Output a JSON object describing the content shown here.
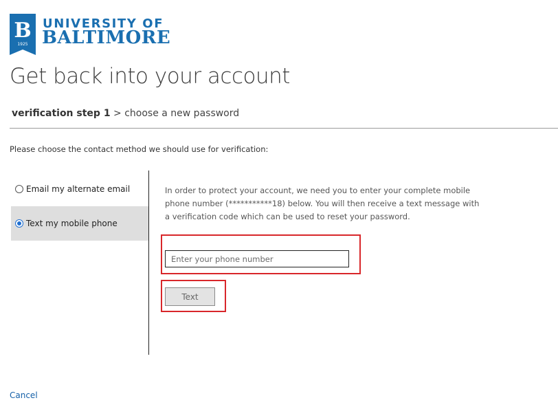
{
  "logo": {
    "line1": "UNIVERSITY OF",
    "line2": "BALTIMORE",
    "shield_letter": "B",
    "shield_year": "1925",
    "brand_color": "#1a6fb0"
  },
  "page": {
    "title": "Get back into your account"
  },
  "steps": {
    "current": "verification step 1",
    "separator": ">",
    "next": "choose a new password"
  },
  "instruction": "Please choose the contact method we should use for verification:",
  "options": [
    {
      "label": "Email my alternate email",
      "selected": false
    },
    {
      "label": "Text my mobile phone",
      "selected": true
    }
  ],
  "detail": {
    "description": "In order to protect your account, we need you to enter your complete mobile phone number (***********18) below. You will then receive a text message with a verification code which can be used to reset your password.",
    "phone_placeholder": "Enter your phone number",
    "phone_value": "",
    "submit_label": "Text",
    "highlight_color": "#d8262a"
  },
  "footer": {
    "cancel_label": "Cancel"
  }
}
